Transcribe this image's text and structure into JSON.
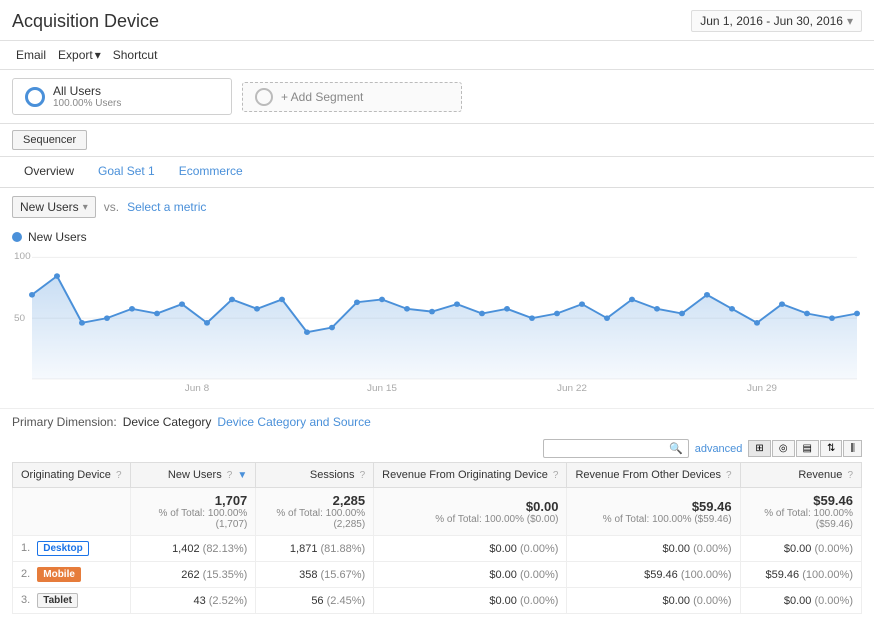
{
  "header": {
    "title": "Acquisition Device",
    "date_range": "Jun 1, 2016 - Jun 30, 2016"
  },
  "toolbar": {
    "email_label": "Email",
    "export_label": "Export",
    "export_arrow": "▾",
    "shortcut_label": "Shortcut"
  },
  "segments": {
    "all_users_label": "All Users",
    "all_users_sublabel": "100.00% Users",
    "add_segment_label": "+ Add Segment"
  },
  "sequencer": {
    "label": "Sequencer"
  },
  "tabs": [
    {
      "id": "overview",
      "label": "Overview",
      "active": true
    },
    {
      "id": "goal-set-1",
      "label": "Goal Set 1",
      "active": false,
      "link": true
    },
    {
      "id": "ecommerce",
      "label": "Ecommerce",
      "active": false,
      "link": true
    }
  ],
  "metric_selector": {
    "metric_label": "New Users",
    "vs_text": "vs.",
    "select_label": "Select a metric"
  },
  "chart": {
    "legend_label": "New Users",
    "y_max": "100",
    "y_mid": "50",
    "y_min": "",
    "x_labels": [
      "",
      "Jun 8",
      "",
      "Jun 15",
      "",
      "Jun 22",
      "",
      "Jun 29"
    ]
  },
  "primary_dimension": {
    "label": "Primary Dimension:",
    "dimension_label": "Device Category",
    "link_label": "Device Category and Source"
  },
  "table_controls": {
    "search_placeholder": "",
    "advanced_label": "advanced"
  },
  "table": {
    "headers": [
      {
        "id": "originating-device",
        "label": "Originating Device",
        "help": true
      },
      {
        "id": "new-users",
        "label": "New Users",
        "help": true,
        "sort": true
      },
      {
        "id": "sessions",
        "label": "Sessions",
        "help": true
      },
      {
        "id": "revenue-originating",
        "label": "Revenue From Originating Device",
        "help": true
      },
      {
        "id": "revenue-other",
        "label": "Revenue From Other Devices",
        "help": true
      },
      {
        "id": "revenue",
        "label": "Revenue",
        "help": true
      }
    ],
    "total_row": {
      "new_users": "1,707",
      "new_users_pct": "% of Total: 100.00% (1,707)",
      "sessions": "2,285",
      "sessions_pct": "% of Total: 100.00% (2,285)",
      "revenue_orig": "$0.00",
      "revenue_orig_pct": "% of Total: 100.00% ($0.00)",
      "revenue_other": "$59.46",
      "revenue_other_pct": "% of Total: 100.00% ($59.46)",
      "revenue": "$59.46",
      "revenue_pct": "% of Total: 100.00% ($59.46)"
    },
    "rows": [
      {
        "num": "1.",
        "device": "Desktop",
        "device_type": "desktop",
        "new_users": "1,402",
        "new_users_pct": "(82.13%)",
        "sessions": "1,871",
        "sessions_pct": "(81.88%)",
        "revenue_orig": "$0.00",
        "revenue_orig_pct": "(0.00%)",
        "revenue_other": "$0.00",
        "revenue_other_pct": "(0.00%)",
        "revenue": "$0.00",
        "revenue_pct": "(0.00%)"
      },
      {
        "num": "2.",
        "device": "Mobile",
        "device_type": "mobile",
        "new_users": "262",
        "new_users_pct": "(15.35%)",
        "sessions": "358",
        "sessions_pct": "(15.67%)",
        "revenue_orig": "$0.00",
        "revenue_orig_pct": "(0.00%)",
        "revenue_other": "$59.46",
        "revenue_other_pct": "(100.00%)",
        "revenue": "$59.46",
        "revenue_pct": "(100.00%)"
      },
      {
        "num": "3.",
        "device": "Tablet",
        "device_type": "tablet",
        "new_users": "43",
        "new_users_pct": "(2.52%)",
        "sessions": "56",
        "sessions_pct": "(2.45%)",
        "revenue_orig": "$0.00",
        "revenue_orig_pct": "(0.00%)",
        "revenue_other": "$0.00",
        "revenue_other_pct": "(0.00%)",
        "revenue": "$0.00",
        "revenue_pct": "(0.00%)"
      }
    ]
  }
}
